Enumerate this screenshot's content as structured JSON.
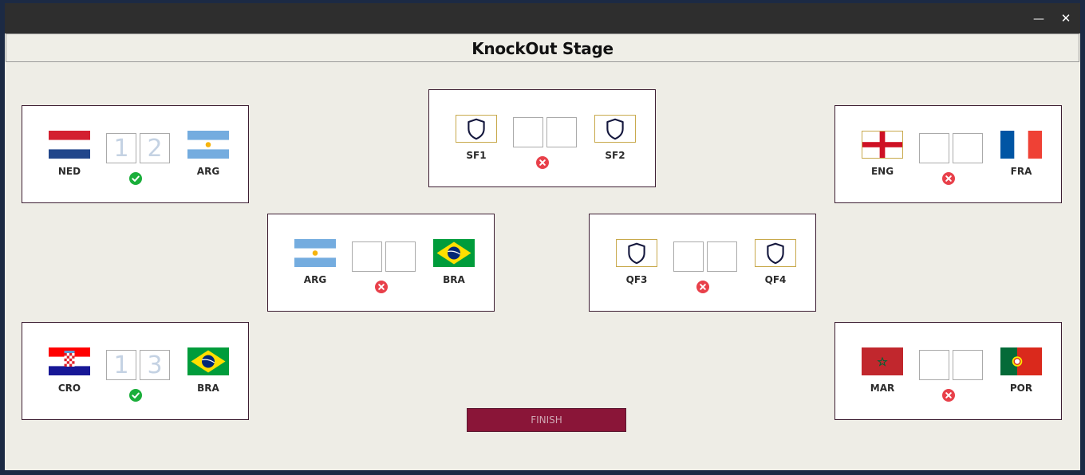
{
  "window": {
    "minimize_glyph": "—",
    "close_glyph": "✕",
    "title": "KnockOut Stage"
  },
  "colors": {
    "titlebar": "#2e2e2e",
    "background": "#eeede6",
    "card_border": "#3d1e33",
    "finish_bg": "#8a1538",
    "finish_text": "#cfa7b3",
    "check_green": "#1aae3a",
    "error_red": "#e8404a",
    "score_digit": "#c4d2e3",
    "placeholder_gold": "#c8a94c"
  },
  "matches": [
    {
      "id": "ned-arg",
      "team_a": {
        "name": "NED",
        "flag": "flag-netherlands"
      },
      "team_b": {
        "name": "ARG",
        "flag": "flag-argentina"
      },
      "score_a": "1",
      "score_b": "2",
      "status": "check-icon"
    },
    {
      "id": "cro-bra",
      "team_a": {
        "name": "CRO",
        "flag": "flag-croatia"
      },
      "team_b": {
        "name": "BRA",
        "flag": "flag-brazil"
      },
      "score_a": "1",
      "score_b": "3",
      "status": "check-icon"
    },
    {
      "id": "sf",
      "team_a": {
        "name": "SF1",
        "flag": "shield-icon"
      },
      "team_b": {
        "name": "SF2",
        "flag": "shield-icon"
      },
      "score_a": "",
      "score_b": "",
      "status": "error-icon"
    },
    {
      "id": "arg-bra",
      "team_a": {
        "name": "ARG",
        "flag": "flag-argentina"
      },
      "team_b": {
        "name": "BRA",
        "flag": "flag-brazil"
      },
      "score_a": "",
      "score_b": "",
      "status": "error-icon"
    },
    {
      "id": "qf",
      "team_a": {
        "name": "QF3",
        "flag": "shield-icon"
      },
      "team_b": {
        "name": "QF4",
        "flag": "shield-icon"
      },
      "score_a": "",
      "score_b": "",
      "status": "error-icon"
    },
    {
      "id": "eng-fra",
      "team_a": {
        "name": "ENG",
        "flag": "flag-england"
      },
      "team_b": {
        "name": "FRA",
        "flag": "flag-france"
      },
      "score_a": "",
      "score_b": "",
      "status": "error-icon"
    },
    {
      "id": "mar-por",
      "team_a": {
        "name": "MAR",
        "flag": "flag-morocco"
      },
      "team_b": {
        "name": "POR",
        "flag": "flag-portugal"
      },
      "score_a": "",
      "score_b": "",
      "status": "error-icon"
    }
  ],
  "finish_label": "FINISH"
}
